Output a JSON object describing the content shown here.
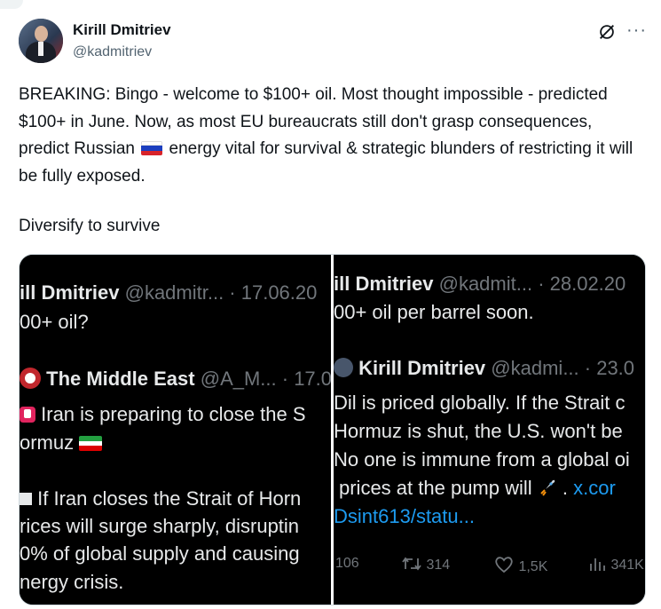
{
  "author": {
    "name": "Kirill Dmitriev",
    "handle": "@kadmitriev"
  },
  "header_icons": {
    "grok": "grok-slash-icon",
    "more": "more-icon",
    "more_glyph": "···"
  },
  "tweet": {
    "text_before_flag": "BREAKING: Bingo - welcome to $100+ oil. Most thought impossible - predicted $100+ in June. Now, as most EU bureaucrats still don't grasp consequences, predict Russian",
    "flag": "russia-flag-icon",
    "text_after_flag": "energy vital for survival & strategic blunders of restricting it will be fully exposed.",
    "second_paragraph": "Diversify to survive"
  },
  "media": {
    "left_panel": {
      "quote_author": "ill Dmitriev",
      "quote_handle_date": "@kadmitr... · 17.06.20",
      "quote_line": "00+ oil?",
      "source_name": "The Middle East",
      "source_handle_date": "@A_M... · 17.0",
      "alert_line": "Iran is preparing to close the S",
      "alert_line2": "ormuz",
      "body_lines": [
        "If Iran closes the Strait of Horn",
        "rices will surge sharply, disruptin",
        "0% of global supply and causing",
        "nergy crisis."
      ]
    },
    "right_panel": {
      "quote_author": "ill Dmitriev",
      "quote_handle_date": "@kadmit... · 28.02.20",
      "quote_line": "00+ oil per barrel soon.",
      "reply_author": "Kirill Dmitriev",
      "reply_handle_date": "@kadmi... · 23.0",
      "body_lines": [
        "Dil is priced globally. If the Strait c",
        "Hormuz is shut, the U.S. won't be",
        "No one is immune from a global oi",
        "prices at the pump will"
      ],
      "link_part1": "x.cor",
      "link_part2": "Dsint613/statu...",
      "stats": {
        "replies": "106",
        "reposts": "314",
        "likes": "1,5K",
        "views": "341K"
      }
    }
  },
  "colors": {
    "text": "#0f1419",
    "secondary": "#536471",
    "dark_bg": "#000000",
    "dark_text": "#e7e9ea",
    "dark_dim": "#71767b",
    "link": "#1d9bf0"
  }
}
